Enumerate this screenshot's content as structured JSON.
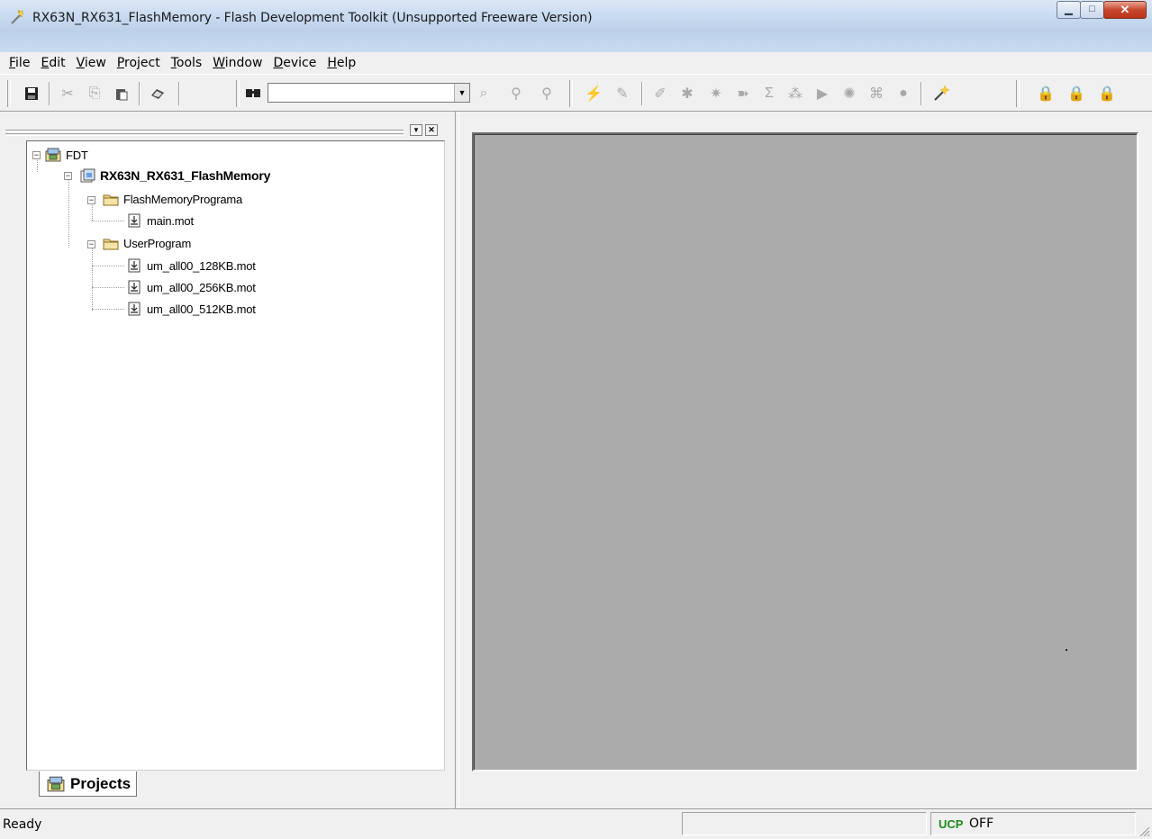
{
  "window": {
    "title": "RX63N_RX631_FlashMemory - Flash Development Toolkit  (Unsupported Freeware Version)",
    "minimize_glyph": "▁",
    "maximize_glyph": "□",
    "close_glyph": "✕"
  },
  "menubar": {
    "items": [
      {
        "acc": "F",
        "rest": "ile"
      },
      {
        "acc": "E",
        "rest": "dit"
      },
      {
        "acc": "V",
        "rest": "iew"
      },
      {
        "acc": "P",
        "rest": "roject"
      },
      {
        "acc": "T",
        "rest": "ools"
      },
      {
        "acc": "W",
        "rest": "indow"
      },
      {
        "acc": "D",
        "rest": "evice"
      },
      {
        "acc": "H",
        "rest": "elp"
      }
    ]
  },
  "toolbar": {
    "combo_value": ""
  },
  "project_pane": {
    "tree": {
      "root": "FDT",
      "project": "RX63N_RX631_FlashMemory",
      "folder1": "FlashMemoryPrograma",
      "folder1_file1": "main.mot",
      "folder2": "UserProgram",
      "folder2_file1": "um_all00_128KB.mot",
      "folder2_file2": "um_all00_256KB.mot",
      "folder2_file3": "um_all00_512KB.mot"
    },
    "tab_label": "Projects"
  },
  "statusbar": {
    "status_text": "Ready",
    "ucp_label": "UCP",
    "ucp_value": "OFF"
  },
  "colors": {
    "workspace_bg": "#ababab",
    "ucp_label": "#1a8c1a",
    "close_button": "#c9472e"
  }
}
